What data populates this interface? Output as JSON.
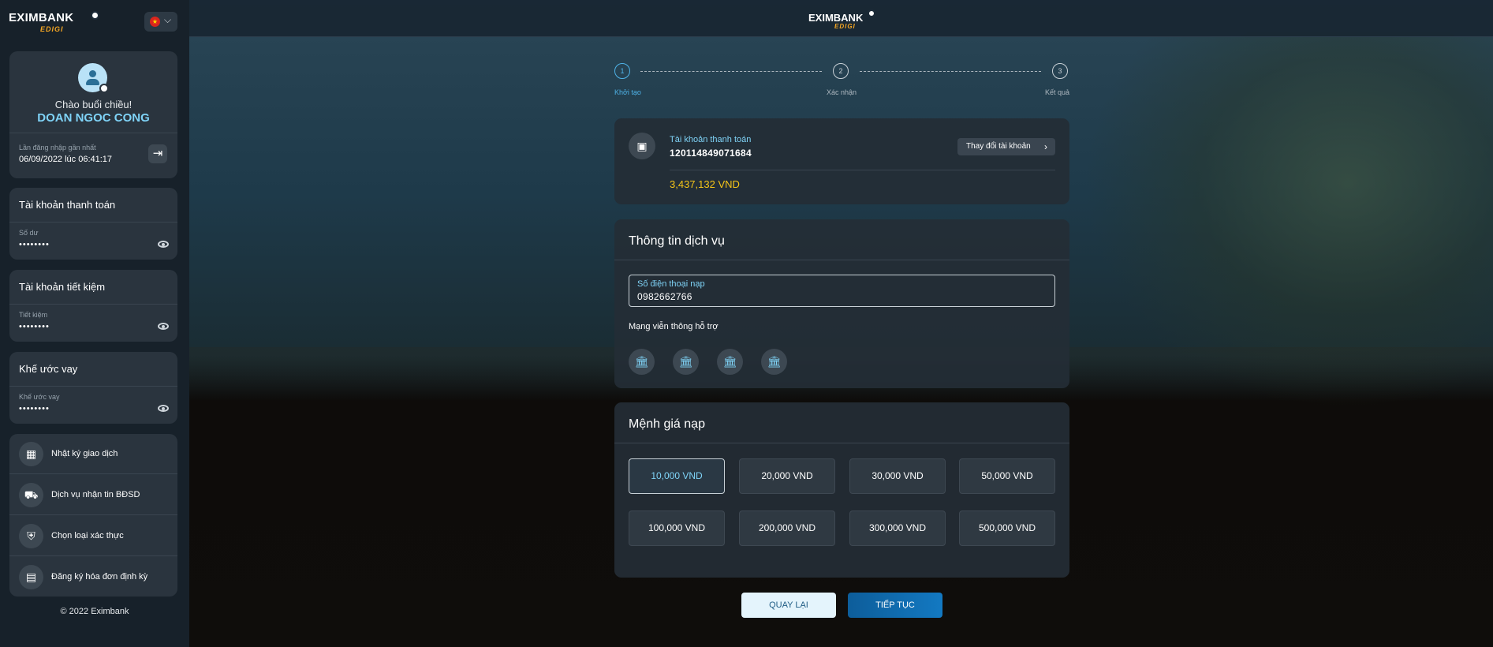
{
  "brand": {
    "name": "EXIMBANK",
    "sub": "EDIGI"
  },
  "language": {
    "icon": "vietnam-flag-icon"
  },
  "profile": {
    "greeting": "Chào buổi chiều!",
    "name": "DOAN NGOC CONG",
    "last_login_label": "Lần đăng nhập gần nhất",
    "last_login_value": "06/09/2022 lúc 06:41:17"
  },
  "accounts": [
    {
      "title": "Tài khoản thanh toán",
      "label": "Số dư",
      "value": "••••••••"
    },
    {
      "title": "Tài khoản tiết kiệm",
      "label": "Tiết kiệm",
      "value": "••••••••"
    },
    {
      "title": "Khế ước vay",
      "label": "Khế ước vay",
      "value": "••••••••"
    }
  ],
  "menu": [
    {
      "label": "Nhật ký giao dịch",
      "icon": "calendar-icon"
    },
    {
      "label": "Dịch vụ nhận tin BĐSD",
      "icon": "truck-icon"
    },
    {
      "label": "Chọn loại xác thực",
      "icon": "shield-icon"
    },
    {
      "label": "Đăng ký hóa đơn định kỳ",
      "icon": "invoice-icon"
    }
  ],
  "copyright": "© 2022 Eximbank",
  "steps": [
    {
      "num": "1",
      "label": "Khởi tạo",
      "active": true
    },
    {
      "num": "2",
      "label": "Xác nhận",
      "active": false
    },
    {
      "num": "3",
      "label": "Kết quả",
      "active": false
    }
  ],
  "source_account": {
    "label": "Tài khoản thanh toán",
    "number": "120114849071684",
    "change_label": "Thay đổi tài khoản",
    "balance": "3,437,132 VND"
  },
  "service": {
    "title": "Thông tin dịch vụ",
    "phone_label": "Số điện thoại nạp",
    "phone_value": "0982662766",
    "network_label": "Mạng viễn thông hỗ trợ",
    "networks": [
      "bank-icon",
      "bank-icon",
      "bank-icon",
      "bank-icon"
    ]
  },
  "denomination": {
    "title": "Mệnh giá nạp",
    "options": [
      "10,000 VND",
      "20,000 VND",
      "30,000 VND",
      "50,000 VND",
      "100,000 VND",
      "200,000 VND",
      "300,000 VND",
      "500,000 VND"
    ],
    "selected": "10,000 VND"
  },
  "actions": {
    "back": "QUAY LẠI",
    "next": "TIẾP TỤC"
  },
  "colors": {
    "accent": "#7fd3f7",
    "balance": "#f5c518",
    "primary_button": "#1379c2"
  }
}
